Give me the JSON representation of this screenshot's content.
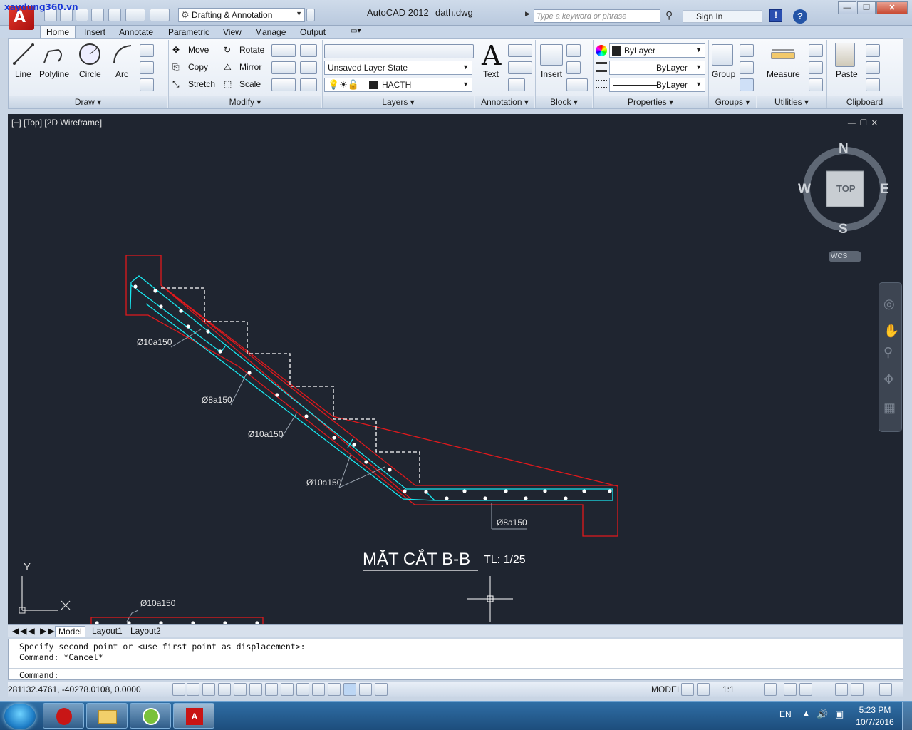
{
  "watermark": "xaydung360.vn",
  "title": {
    "app": "AutoCAD 2012",
    "file": "dath.dwg",
    "workspace": "Drafting & Annotation",
    "search_placeholder": "Type a keyword or phrase",
    "signin": "Sign In"
  },
  "tabs": [
    "Home",
    "Insert",
    "Annotate",
    "Parametric",
    "View",
    "Manage",
    "Output"
  ],
  "draw": {
    "line": "Line",
    "polyline": "Polyline",
    "circle": "Circle",
    "arc": "Arc",
    "panel": "Draw"
  },
  "modify": {
    "move": "Move",
    "rotate": "Rotate",
    "copy": "Copy",
    "mirror": "Mirror",
    "stretch": "Stretch",
    "scale": "Scale",
    "panel": "Modify"
  },
  "layers": {
    "state": "Unsaved Layer State",
    "current": "HACTH",
    "panel": "Layers"
  },
  "annotation": {
    "text": "Text",
    "panel": "Annotation"
  },
  "block": {
    "insert": "Insert",
    "panel": "Block"
  },
  "properties": {
    "color": "ByLayer",
    "linetype": "ByLayer",
    "lineweight": "ByLayer",
    "panel": "Properties"
  },
  "groups": {
    "group": "Group",
    "panel": "Groups"
  },
  "utilities": {
    "measure": "Measure",
    "panel": "Utilities"
  },
  "clipboard": {
    "paste": "Paste",
    "panel": "Clipboard"
  },
  "viewport": {
    "label": "[−] [Top] [2D Wireframe]",
    "cube_top": "TOP",
    "n": "N",
    "s": "S",
    "e": "E",
    "w": "W",
    "wcs": "WCS"
  },
  "drawing": {
    "title": "MẶT CẮT B-B",
    "scale": "TL: 1/25",
    "labels": [
      "Ø10a150",
      "Ø8a150",
      "Ø10a150",
      "Ø10a150",
      "Ø8a150",
      "Ø10a150"
    ],
    "ucs_y": "Y"
  },
  "colors": {
    "bg": "#1f2530",
    "outline": "#e0191c",
    "rebar": "#19e8f0",
    "steps": "#ffffff"
  },
  "layout_tabs": [
    "Model",
    "Layout1",
    "Layout2"
  ],
  "command": {
    "line1": "Specify second point or <use first point as displacement>:",
    "line2": "Command: *Cancel*",
    "prompt": "Command:"
  },
  "status": {
    "coords": "281132.4761, -40278.0108, 0.0000",
    "model": "MODEL",
    "scale": "1:1"
  },
  "taskbar": {
    "lang": "EN",
    "time": "5:23 PM",
    "date": "10/7/2016"
  }
}
